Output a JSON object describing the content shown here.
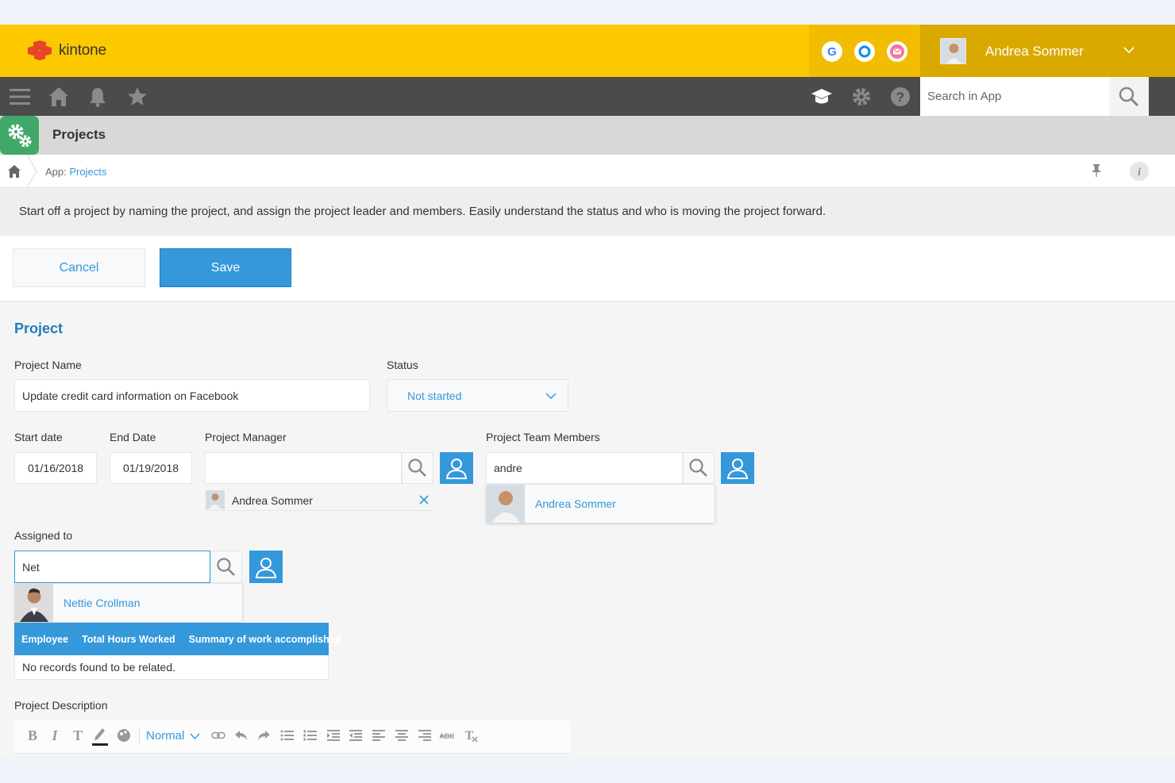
{
  "header": {
    "brand": "kintone",
    "user_name": "Andrea Sommer",
    "colors": {
      "topbar": "#fcc800",
      "navbar": "#4b4b4b",
      "accent": "#3498db",
      "app_icon": "#41a86a"
    }
  },
  "nav": {
    "search_placeholder": "Search in App"
  },
  "app": {
    "title": "Projects",
    "breadcrumb_prefix": "App:",
    "breadcrumb_link": "Projects",
    "description": "Start off a project by naming the project, and assign the project leader and members. Easily understand the status and who is moving the project forward."
  },
  "actions": {
    "cancel": "Cancel",
    "save": "Save"
  },
  "form": {
    "section_title": "Project",
    "project_name_label": "Project Name",
    "project_name_value": "Update credit card information on Facebook",
    "status_label": "Status",
    "status_value": "Not started",
    "start_date_label": "Start date",
    "start_date_value": "01/16/2018",
    "end_date_label": "End Date",
    "end_date_value": "01/19/2018",
    "manager_label": "Project Manager",
    "manager_input_value": "",
    "manager_selected": "Andrea Sommer",
    "team_label": "Project Team Members",
    "team_input_value": "andre",
    "team_suggestion": "Andrea Sommer",
    "assigned_label": "Assigned to",
    "assigned_input_value": "Net",
    "assigned_suggestion": "Nettie Crollman",
    "related_columns": [
      "Employee",
      "Total Hours Worked",
      "Summary of work accomplished"
    ],
    "related_empty": "No records found to be related.",
    "description_label": "Project Description",
    "editor_font": "Normal"
  }
}
